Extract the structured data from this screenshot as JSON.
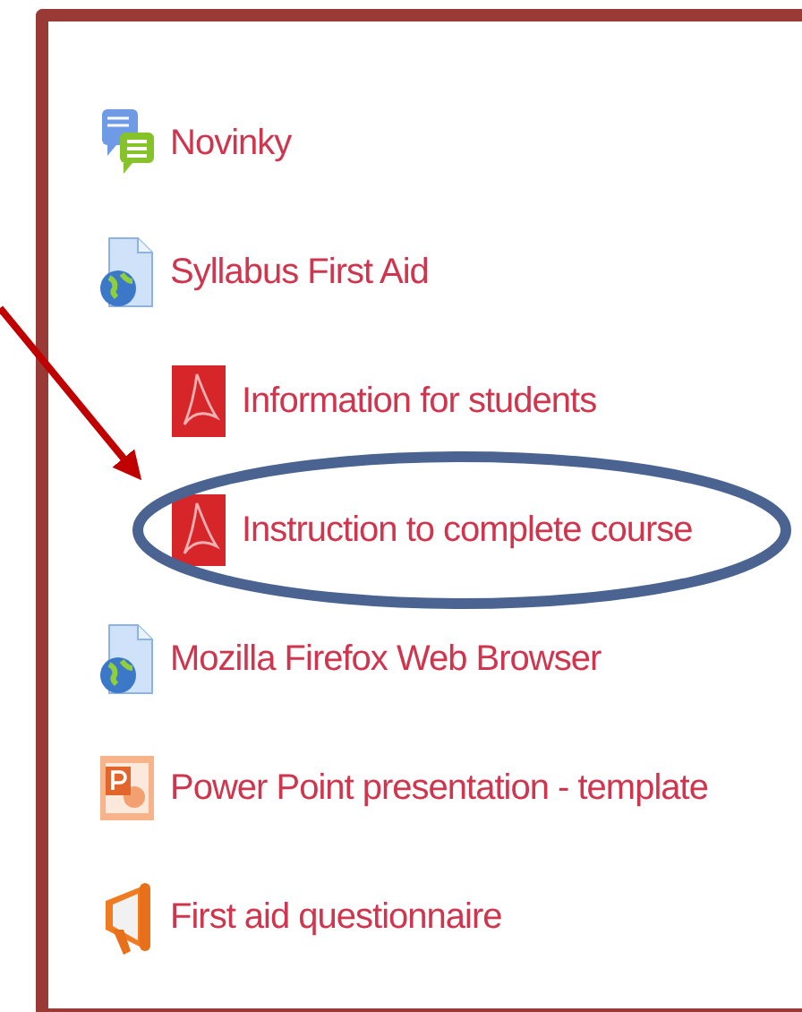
{
  "activities": [
    {
      "kind": "forum",
      "title": "Novinky",
      "circled": false
    },
    {
      "kind": "url",
      "title": "Syllabus First Aid",
      "circled": false,
      "children": [
        {
          "kind": "pdf",
          "title": "Information for students",
          "circled": false
        },
        {
          "kind": "pdf",
          "title": "Instruction to complete course",
          "circled": true
        }
      ]
    },
    {
      "kind": "url",
      "title": "Mozilla Firefox Web Browser",
      "circled": false
    },
    {
      "kind": "ppt",
      "title": "Power Point presentation - template",
      "circled": false
    },
    {
      "kind": "feedback",
      "title": "First aid questionnaire",
      "circled": false
    }
  ]
}
